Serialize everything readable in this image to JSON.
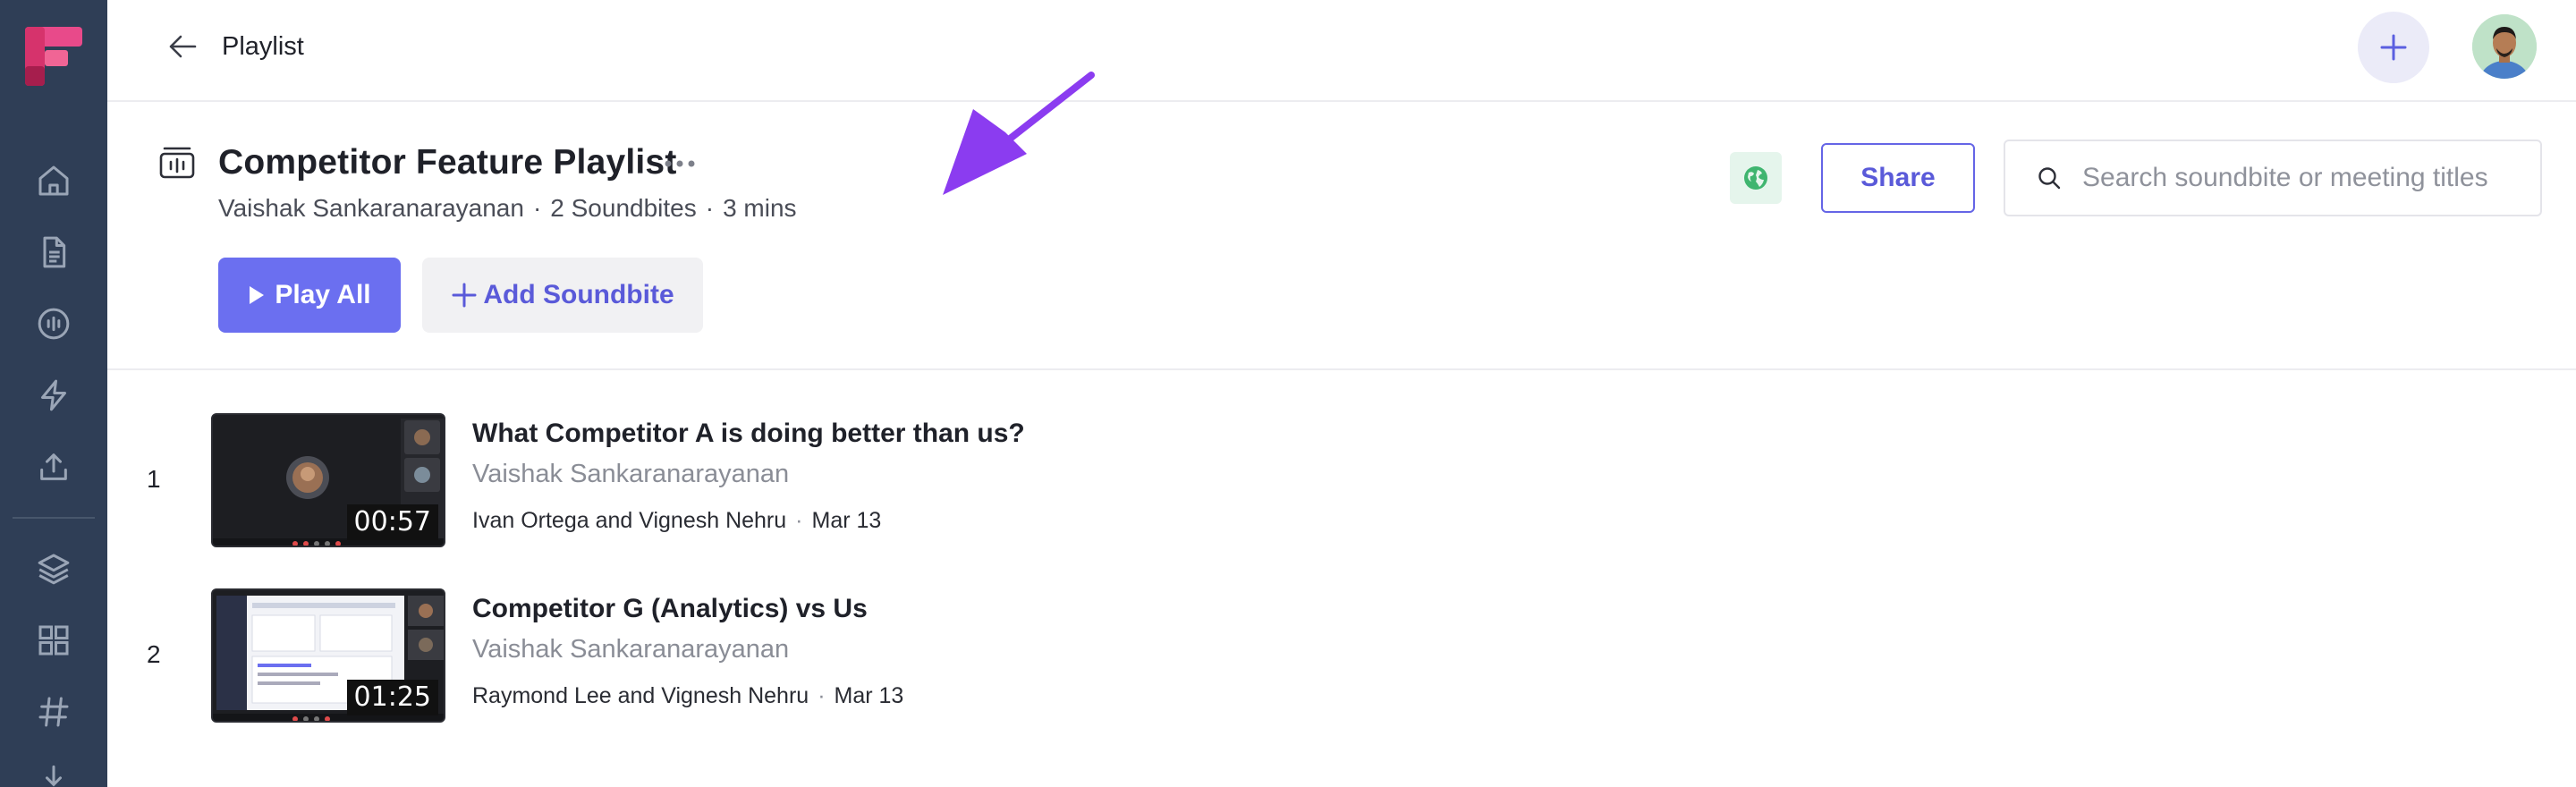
{
  "topbar": {
    "title": "Playlist"
  },
  "playlist": {
    "title": "Competitor Feature Playlist",
    "owner": "Vaishak Sankaranarayanan",
    "soundbite_count": "2 Soundbites",
    "duration": "3 mins",
    "meta_separator": "·"
  },
  "actions": {
    "share_label": "Share",
    "play_all_label": "Play All",
    "add_soundbite_label": "Add Soundbite",
    "search_placeholder": "Search soundbite or meeting titles",
    "search_value": ""
  },
  "colors": {
    "sidebar_bg": "#2f3e56",
    "accent": "#6b6ff0",
    "annotation_arrow": "#8b3cf0"
  },
  "icons": {
    "sidebar": [
      "home-icon",
      "document-icon",
      "soundwave-icon",
      "lightning-icon",
      "upload-icon",
      "layers-icon",
      "grid-icon",
      "hashtag-icon",
      "download-icon"
    ]
  },
  "soundbites": [
    {
      "index": "1",
      "title": "What Competitor A is doing better than us?",
      "owner": "Vaishak Sankaranarayanan",
      "participants": "Ivan Ortega and Vignesh Nehru",
      "date": "Mar 13",
      "duration": "00:57"
    },
    {
      "index": "2",
      "title": "Competitor G (Analytics) vs Us",
      "owner": "Vaishak Sankaranarayanan",
      "participants": "Raymond Lee and Vignesh Nehru",
      "date": "Mar 13",
      "duration": "01:25"
    }
  ]
}
